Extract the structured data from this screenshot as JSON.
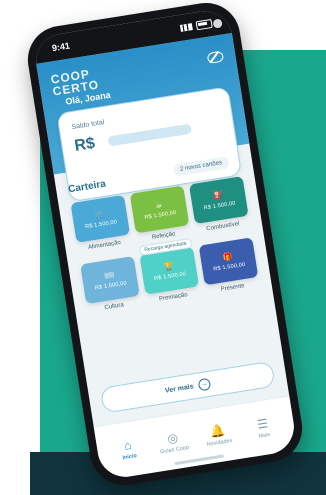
{
  "status_bar": {
    "time": "9:41"
  },
  "app": {
    "brand_line1": "COOP",
    "brand_line2": "CERTO"
  },
  "balance_card": {
    "greeting": "Olá, Joana",
    "label": "Saldo total",
    "currency": "R$",
    "more_label": "2 novos cartões"
  },
  "wallet": {
    "title": "Carteira",
    "tiles": [
      {
        "label": "Alimentação",
        "value": "R$ 1.500,00",
        "icon": "cart-icon",
        "color": "#4aa9d6"
      },
      {
        "label": "Refeição",
        "value": "R$ 1.500,00",
        "icon": "cup-icon",
        "color": "#7cc043"
      },
      {
        "label": "Combustível",
        "value": "R$ 1.500,00",
        "icon": "fuel-icon",
        "color": "#1f8f82"
      },
      {
        "label": "Cultura",
        "value": "R$ 1.500,00",
        "icon": "ticket-icon",
        "color": "#6fb4db"
      },
      {
        "label": "Premiação",
        "value": "R$ 1.500,00",
        "icon": "trophy-icon",
        "color": "#4fd1c7",
        "badge": "Recarga agendada"
      },
      {
        "label": "Presente",
        "value": "R$ 1.500,00",
        "icon": "gift-icon",
        "color": "#3a5dae"
      }
    ],
    "see_more": "Ver mais"
  },
  "nav": {
    "items": [
      {
        "label": "Início",
        "icon": "home-icon",
        "active": true
      },
      {
        "label": "Guias Coop",
        "icon": "location-icon"
      },
      {
        "label": "Novidades",
        "icon": "bell-icon"
      },
      {
        "label": "Mais",
        "icon": "menu-icon"
      }
    ]
  }
}
